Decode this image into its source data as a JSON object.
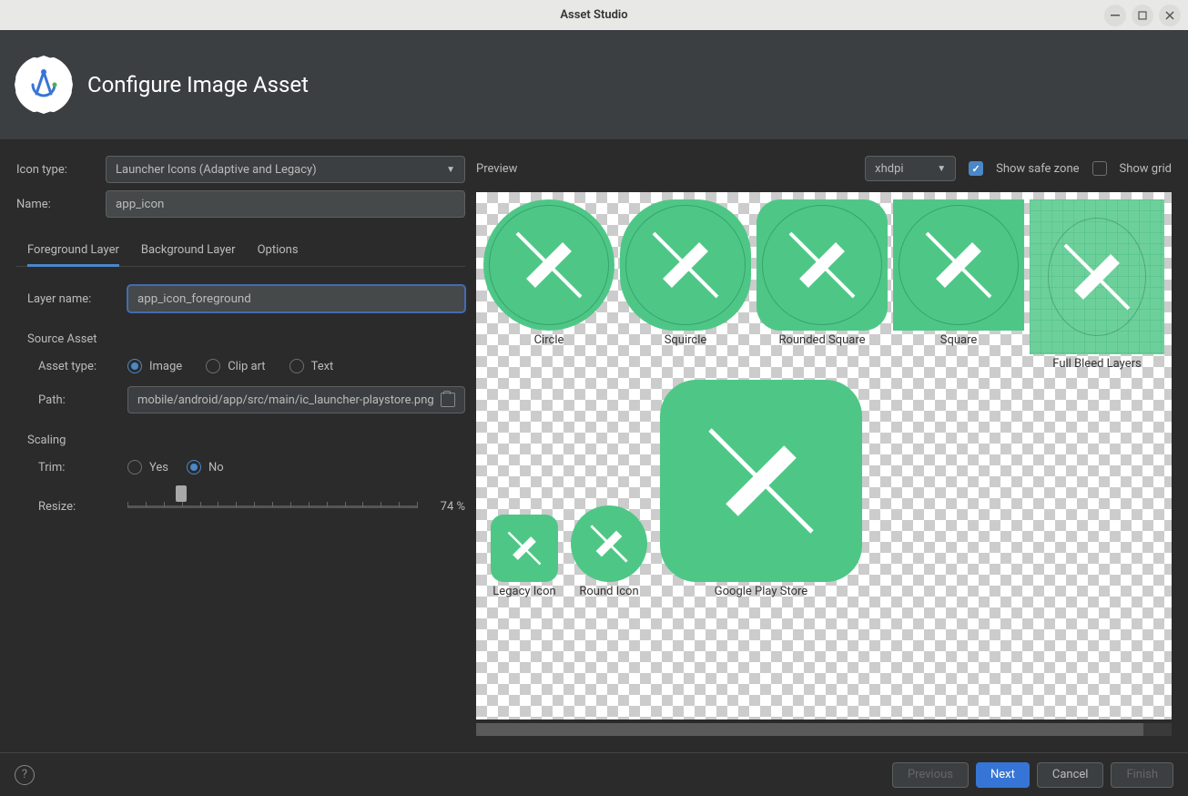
{
  "window": {
    "title": "Asset Studio"
  },
  "header": {
    "title": "Configure Image Asset"
  },
  "form": {
    "icon_type_label": "Icon type:",
    "icon_type_value": "Launcher Icons (Adaptive and Legacy)",
    "name_label": "Name:",
    "name_value": "app_icon"
  },
  "tabs": {
    "foreground": "Foreground Layer",
    "background": "Background Layer",
    "options": "Options"
  },
  "layer": {
    "name_label": "Layer name:",
    "name_value": "app_icon_foreground"
  },
  "source": {
    "title": "Source Asset",
    "asset_type_label": "Asset type:",
    "image": "Image",
    "clipart": "Clip art",
    "text": "Text",
    "path_label": "Path:",
    "path_value": "mobile/android/app/src/main/ic_launcher-playstore.png"
  },
  "scaling": {
    "title": "Scaling",
    "trim_label": "Trim:",
    "yes": "Yes",
    "no": "No",
    "resize_label": "Resize:",
    "resize_value": "74 %"
  },
  "preview": {
    "label": "Preview",
    "density": "xhdpi",
    "safe_zone": "Show safe zone",
    "show_grid": "Show grid",
    "shapes": {
      "circle": "Circle",
      "squircle": "Squircle",
      "rounded": "Rounded Square",
      "square": "Square",
      "full": "Full Bleed Layers",
      "legacy": "Legacy Icon",
      "round": "Round Icon",
      "playstore": "Google Play Store"
    }
  },
  "footer": {
    "previous": "Previous",
    "next": "Next",
    "cancel": "Cancel",
    "finish": "Finish"
  },
  "icon_color": "#4ec786"
}
